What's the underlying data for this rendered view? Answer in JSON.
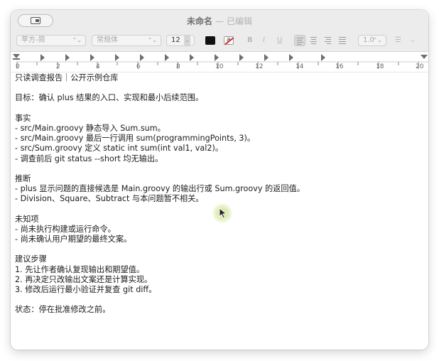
{
  "window": {
    "title": "未命名",
    "separator": "—",
    "subtitle": "已编辑"
  },
  "toolbar": {
    "font_family": "苹方-简",
    "font_style": "常规体",
    "font_size": "12",
    "bold": "B",
    "italic": "I",
    "underline": "U",
    "line_spacing": "1.0",
    "text_color": "#111111",
    "highlight_glyph": "a"
  },
  "ruler": {
    "labels": [
      "0",
      "2",
      "4",
      "6",
      "8",
      "10",
      "12",
      "14",
      "16",
      "18",
      "20"
    ]
  },
  "document": {
    "lines": [
      "只读调查报告｜公开示例仓库",
      "",
      "目标：确认 plus 结果的入口、实现和最小后续范围。",
      "",
      "事实",
      "- src/Main.groovy 静态导入 Sum.sum。",
      "- src/Main.groovy 最后一行调用 sum(programmingPoints, 3)。",
      "- src/Sum.groovy 定义 static int sum(int val1, val2)。",
      "- 调查前后 git status --short 均无输出。",
      "",
      "推断",
      "- plus 显示问题的直接候选是 Main.groovy 的输出行或 Sum.groovy 的返回值。",
      "- Division、Square、Subtract 与本问题暂不相关。",
      "",
      "未知项",
      "- 尚未执行构建或运行命令。",
      "- 尚未确认用户期望的最终文案。",
      "",
      "建议步骤",
      "1. 先让作者确认复现输出和期望值。",
      "2. 再决定只改输出文案还是计算实现。",
      "3. 修改后运行最小验证并复查 git diff。",
      "",
      "状态：停在批准修改之前。"
    ]
  }
}
